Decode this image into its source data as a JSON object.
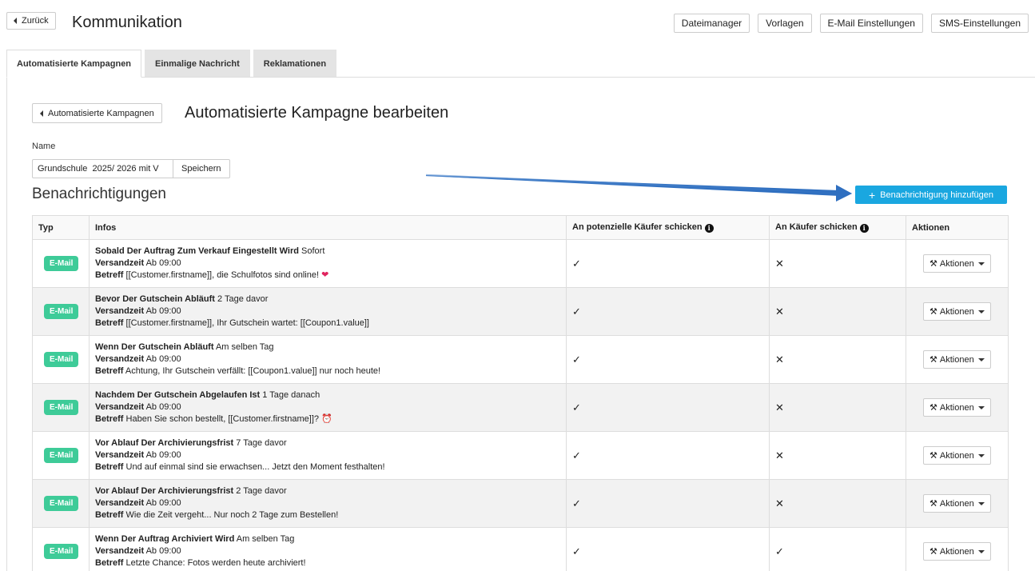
{
  "header": {
    "back_label": "Zurück",
    "title": "Kommunikation",
    "buttons": [
      "Dateimanager",
      "Vorlagen",
      "E-Mail Einstellungen",
      "SMS-Einstellungen"
    ]
  },
  "tabs": [
    {
      "label": "Automatisierte Kampagnen",
      "active": true
    },
    {
      "label": "Einmalige Nachricht",
      "active": false
    },
    {
      "label": "Reklamationen",
      "active": false
    }
  ],
  "campaign": {
    "back_label": "Automatisierte Kampagnen",
    "title": "Automatisierte Kampagne bearbeiten",
    "name_label": "Name",
    "name_value": "Grundschule  2025/ 2026 mit V",
    "save_label": "Speichern"
  },
  "notifications": {
    "title": "Benachrichtigungen",
    "add_label": "Benachrichtigung hinzufügen",
    "accent_color": "#1aa7e0",
    "badge_color": "#3ecb98",
    "columns": [
      "Typ",
      "Infos",
      "An potenzielle Käufer schicken",
      "An Käufer schicken",
      "Aktionen"
    ],
    "rows": [
      {
        "type": "E-Mail",
        "event": "Sobald Der Auftrag Zum Verkauf Eingestellt Wird",
        "timing": "Sofort",
        "send_label": "Versandzeit",
        "send_time": "Ab 09:00",
        "subject_label": "Betreff",
        "subject": "[[Customer.firstname]], die Schulfotos sind online!",
        "emoji": "❤",
        "potential": "✓",
        "buyers": "✕",
        "action": "Aktionen"
      },
      {
        "type": "E-Mail",
        "event": "Bevor Der Gutschein Abläuft",
        "timing": "2 Tage davor",
        "send_label": "Versandzeit",
        "send_time": "Ab 09:00",
        "subject_label": "Betreff",
        "subject": "[[Customer.firstname]], Ihr Gutschein wartet: [[Coupon1.value]]",
        "emoji": "",
        "potential": "✓",
        "buyers": "✕",
        "action": "Aktionen"
      },
      {
        "type": "E-Mail",
        "event": "Wenn Der Gutschein Abläuft",
        "timing": "Am selben Tag",
        "send_label": "Versandzeit",
        "send_time": "Ab 09:00",
        "subject_label": "Betreff",
        "subject": "Achtung, Ihr Gutschein verfällt: [[Coupon1.value]] nur noch heute!",
        "emoji": "",
        "potential": "✓",
        "buyers": "✕",
        "action": "Aktionen"
      },
      {
        "type": "E-Mail",
        "event": "Nachdem Der Gutschein Abgelaufen Ist",
        "timing": "1 Tage danach",
        "send_label": "Versandzeit",
        "send_time": "Ab 09:00",
        "subject_label": "Betreff",
        "subject": "Haben Sie schon bestellt, [[Customer.firstname]]?",
        "emoji": "⏰",
        "potential": "✓",
        "buyers": "✕",
        "action": "Aktionen"
      },
      {
        "type": "E-Mail",
        "event": "Vor Ablauf Der Archivierungsfrist",
        "timing": "7 Tage davor",
        "send_label": "Versandzeit",
        "send_time": "Ab 09:00",
        "subject_label": "Betreff",
        "subject": "Und auf einmal sind sie erwachsen... Jetzt den Moment festhalten!",
        "emoji": "",
        "potential": "✓",
        "buyers": "✕",
        "action": "Aktionen"
      },
      {
        "type": "E-Mail",
        "event": "Vor Ablauf Der Archivierungsfrist",
        "timing": "2 Tage davor",
        "send_label": "Versandzeit",
        "send_time": "Ab 09:00",
        "subject_label": "Betreff",
        "subject": "Wie die Zeit vergeht... Nur noch 2 Tage zum Bestellen!",
        "emoji": "",
        "potential": "✓",
        "buyers": "✕",
        "action": "Aktionen"
      },
      {
        "type": "E-Mail",
        "event": "Wenn Der Auftrag Archiviert Wird",
        "timing": "Am selben Tag",
        "send_label": "Versandzeit",
        "send_time": "Ab 09:00",
        "subject_label": "Betreff",
        "subject": "Letzte Chance: Fotos werden heute archiviert!",
        "emoji": "",
        "potential": "✓",
        "buyers": "✓",
        "action": "Aktionen"
      }
    ]
  }
}
